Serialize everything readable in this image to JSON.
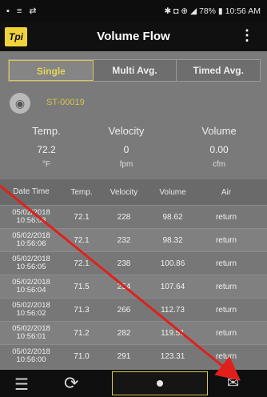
{
  "status_bar": {
    "left_icons": "▪ ≡ ⇄",
    "right_text": "✱ ◘ ⊕ ◢ 78% ▮ 10:56 AM"
  },
  "app_bar": {
    "logo": "Tpi",
    "title": "Volume Flow",
    "menu_icon": "⋮"
  },
  "tabs": [
    {
      "label": "Single",
      "active": true
    },
    {
      "label": "Multi Avg.",
      "active": false
    },
    {
      "label": "Timed Avg.",
      "active": false
    }
  ],
  "device": {
    "name": "ST-00019"
  },
  "summary": {
    "temp": {
      "label": "Temp.",
      "value": "72.2",
      "unit": "°F"
    },
    "velocity": {
      "label": "Velocity",
      "value": "0",
      "unit": "fpm"
    },
    "volume": {
      "label": "Volume",
      "value": "0.00",
      "unit": "cfm"
    }
  },
  "table": {
    "headers": [
      "Date Time",
      "Temp.",
      "Velocity",
      "Volume",
      "Air"
    ],
    "rows": [
      [
        "05/02/2018 10:56:08",
        "72.1",
        "228",
        "98.62",
        "return"
      ],
      [
        "05/02/2018 10:56:06",
        "72.1",
        "232",
        "98.32",
        "return"
      ],
      [
        "05/02/2018 10:56:05",
        "72.1",
        "238",
        "100.86",
        "return"
      ],
      [
        "05/02/2018 10:56:04",
        "71.5",
        "254",
        "107.64",
        "return"
      ],
      [
        "05/02/2018 10:56:02",
        "71.3",
        "266",
        "112.73",
        "return"
      ],
      [
        "05/02/2018 10:56:01",
        "71.2",
        "282",
        "119.51",
        "return"
      ],
      [
        "05/02/2018 10:56:00",
        "71.0",
        "291",
        "123.31",
        "return"
      ]
    ]
  },
  "bottom_bar": {
    "list_icon": "☰",
    "refresh_icon": "⟳",
    "mail_icon": "✉"
  },
  "colors": {
    "accent": "#e6d55a",
    "panel": "#7a7a7a",
    "annotation_arrow": "#e0201c"
  }
}
